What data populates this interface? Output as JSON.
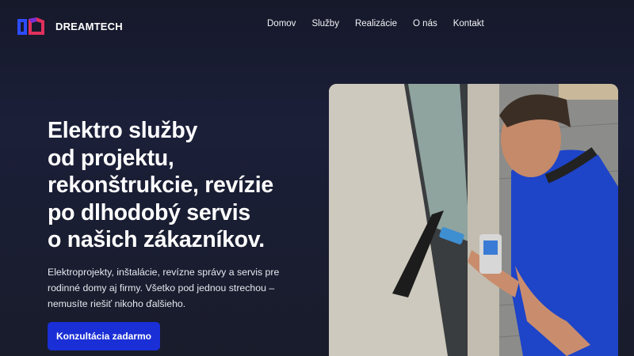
{
  "brand": {
    "name": "DREAMTECH",
    "logo_colors": [
      "#2d4bff",
      "#e0305c"
    ]
  },
  "nav": {
    "items": [
      {
        "label": "Domov"
      },
      {
        "label": "Služby"
      },
      {
        "label": "Realizácie"
      },
      {
        "label": "O nás"
      },
      {
        "label": "Kontakt"
      }
    ]
  },
  "hero": {
    "title_lines": [
      "Elektro služby",
      "od projektu,",
      "rekonštrukcie, revízie",
      "po dlhodobý servis",
      "o našich zákazníkov."
    ],
    "subtitle_lines": [
      "Elektroprojekty, inštalácie, revízne správy a servis pre",
      "rodinné domy aj firmy. Všetko pod jednou strechou –",
      "nemusíte riešiť nikoho ďalšieho."
    ],
    "cta_label": "Konzultácia zadarmo"
  },
  "colors": {
    "accent": "#1a2fd6",
    "background": "#1b1f38"
  }
}
